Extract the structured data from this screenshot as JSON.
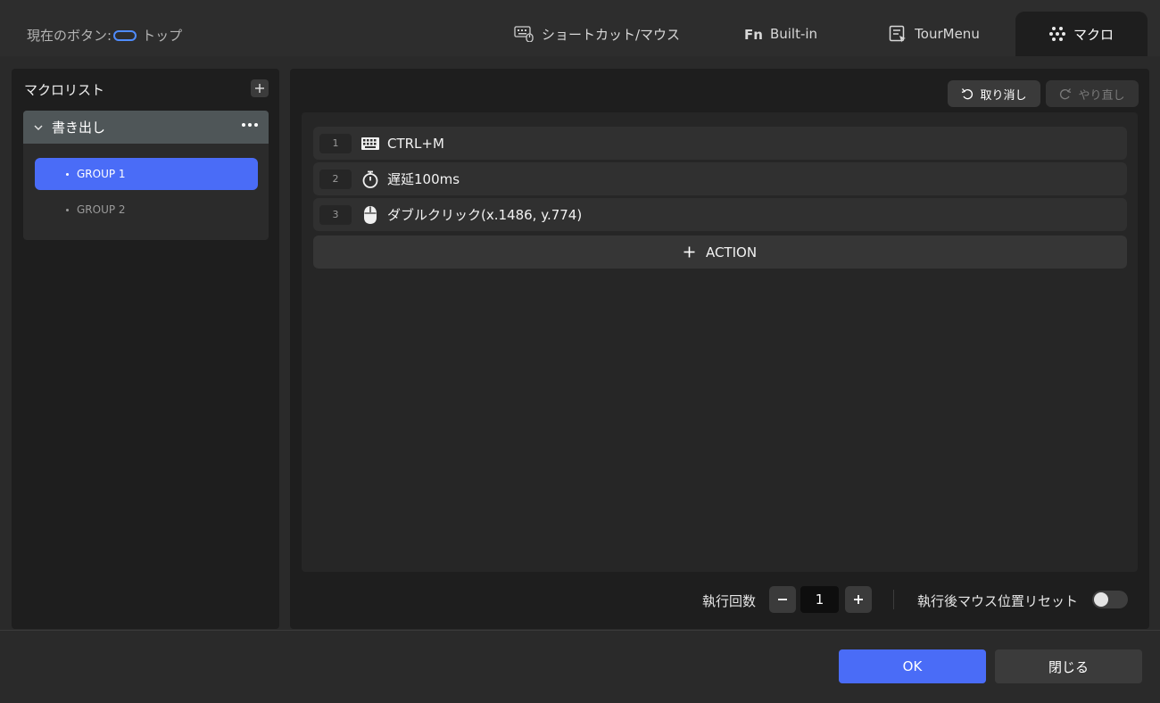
{
  "header": {
    "current_button_label": "現在のボタン:",
    "current_button_value": "トップ",
    "tabs": [
      {
        "label": "ショートカット/マウス",
        "icon": "keyboard-mouse-icon"
      },
      {
        "label": "Built-in",
        "icon": "fn-icon"
      },
      {
        "label": "TourMenu",
        "icon": "tour-menu-icon"
      },
      {
        "label": "マクロ",
        "icon": "macro-icon",
        "active": true
      }
    ]
  },
  "macro_list": {
    "title": "マクロリスト",
    "macros": [
      {
        "name": "書き出し",
        "expanded": true,
        "groups": [
          {
            "label": "GROUP 1",
            "selected": true
          },
          {
            "label": "GROUP 2",
            "selected": false
          }
        ]
      }
    ]
  },
  "editor": {
    "undo_label": "取り消し",
    "redo_label": "やり直し",
    "actions": [
      {
        "index": "1",
        "icon": "keyboard-icon",
        "label": "CTRL+M"
      },
      {
        "index": "2",
        "icon": "timer-icon",
        "label": "遅延100ms"
      },
      {
        "index": "3",
        "icon": "mouse-icon",
        "label": "ダブルクリック(x.1486, y.774)"
      }
    ],
    "add_action_label": "ACTION",
    "run_count_label": "執行回数",
    "run_count_value": "1",
    "reset_mouse_label": "執行後マウス位置リセット",
    "reset_mouse_enabled": false
  },
  "footer": {
    "ok_label": "OK",
    "close_label": "閉じる"
  },
  "colors": {
    "accent": "#4a6cf7",
    "background": "#2a2a2a",
    "panel": "#1e1e1e"
  }
}
